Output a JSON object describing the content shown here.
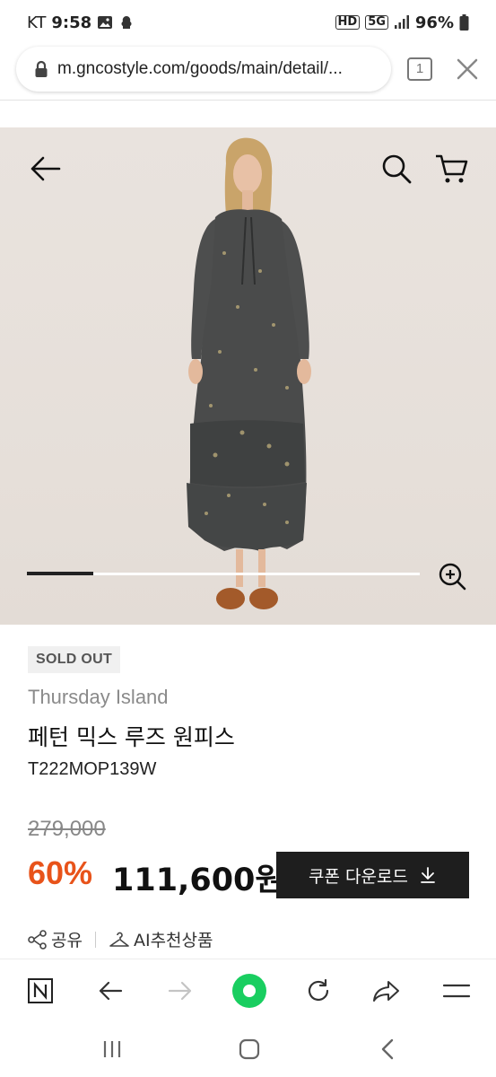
{
  "status": {
    "carrier": "KT",
    "time": "9:58",
    "battery": "96%",
    "hd_label": "HD",
    "net_label": "5G"
  },
  "browser": {
    "url": "m.gncostyle.com/goods/main/detail/...",
    "tab_count": "1"
  },
  "hero": {
    "gallery_progress": 0.17
  },
  "product": {
    "status_badge": "SOLD OUT",
    "brand": "Thursday Island",
    "name": "페턴 믹스 루즈 원피스",
    "code": "T222MOP139W",
    "original_price": "279,000",
    "discount": "60%",
    "price": "111,600원",
    "coupon_label": "쿠폰 다운로드"
  },
  "actions": {
    "share": "공유",
    "ai_recommend": "AI추천상품"
  },
  "icons": {
    "back": "arrow-left-icon",
    "search": "search-icon",
    "cart": "cart-icon",
    "zoom": "zoom-in-icon",
    "lock": "lock-icon",
    "close": "close-icon",
    "download": "download-icon",
    "share": "share-icon",
    "hanger": "hanger-icon"
  },
  "colors": {
    "discount": "#e8531a",
    "coupon_bg": "#1e1e1e",
    "home_green": "#19ce60"
  }
}
